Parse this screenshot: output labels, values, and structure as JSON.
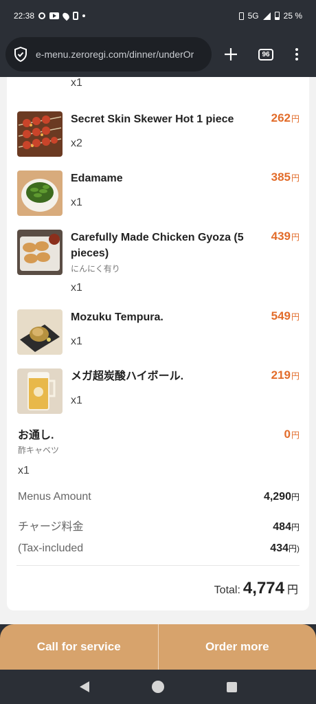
{
  "status": {
    "time": "22:38",
    "network": "5G",
    "battery": "25 %"
  },
  "browser": {
    "url": "e-menu.zeroregi.com/dinner/underOr",
    "tab_count": "96"
  },
  "items": [
    {
      "name": "",
      "note": "",
      "qty": "x1",
      "price": "",
      "thumb": "top-partial"
    },
    {
      "name": "Secret Skin Skewer Hot 1 piece",
      "note": "",
      "qty": "x2",
      "price": "262",
      "thumb": "skewer"
    },
    {
      "name": "Edamame",
      "note": "",
      "qty": "x1",
      "price": "385",
      "thumb": "edamame"
    },
    {
      "name": "Carefully Made Chicken Gyoza (5 pieces)",
      "note": "にんにく有り",
      "qty": "x1",
      "price": "439",
      "thumb": "gyoza"
    },
    {
      "name": "Mozuku Tempura.",
      "note": "",
      "qty": "x1",
      "price": "549",
      "thumb": "tempura"
    },
    {
      "name": "メガ超炭酸ハイボール.",
      "note": "",
      "qty": "x1",
      "price": "219",
      "thumb": "highball"
    }
  ],
  "otoshi": {
    "name": "お通し.",
    "note": "酢キャベツ",
    "qty": "x1",
    "price": "0"
  },
  "currency": "円",
  "summary": {
    "menus_amount_label": "Menus Amount",
    "menus_amount_value": "4,290",
    "charge_label": "チャージ料金",
    "charge_value": "484",
    "tax_label": "(Tax-included",
    "tax_value": "434",
    "tax_suffix": "円)",
    "total_label": "Total:",
    "total_value": "4,774"
  },
  "actions": {
    "call_label": "Call for service",
    "order_label": "Order more"
  },
  "colors": {
    "accent_price": "#e26c2a",
    "action_bar": "#d7a36c"
  }
}
